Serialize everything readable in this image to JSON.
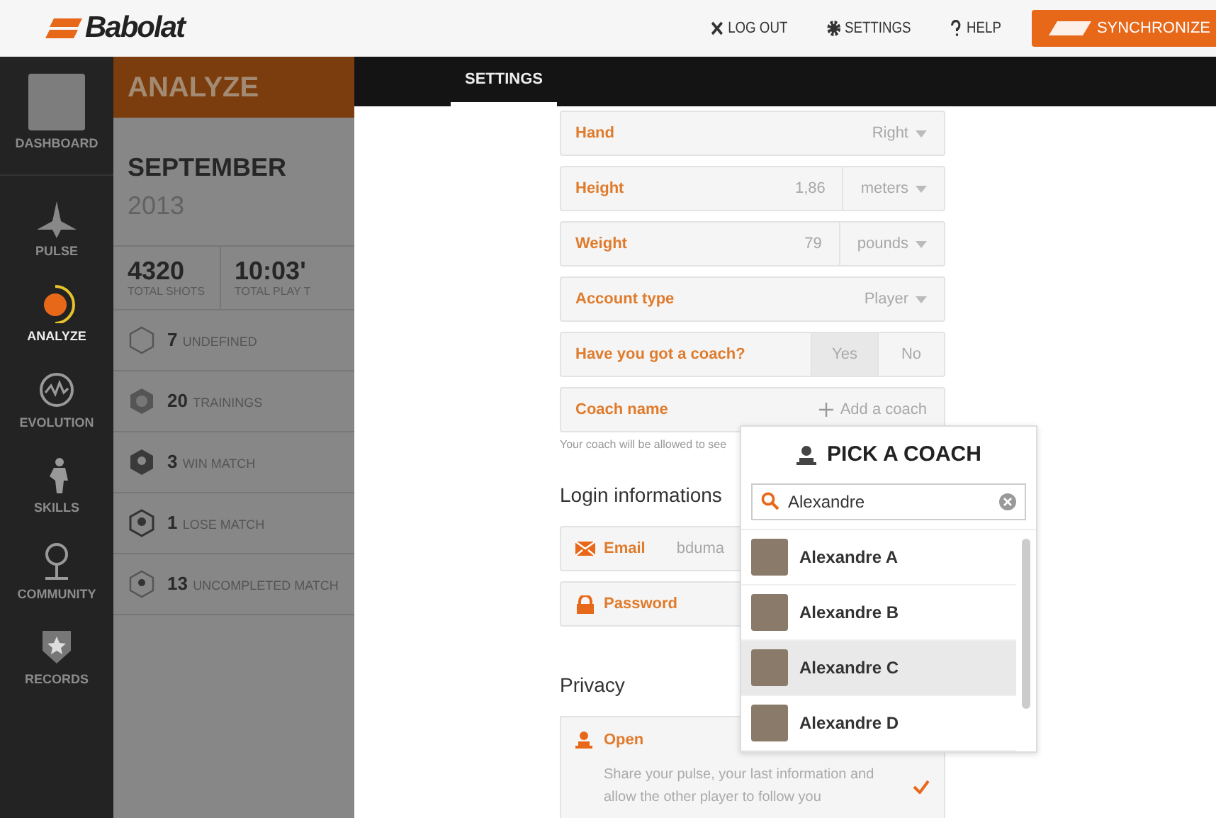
{
  "brand": {
    "logo": "Babolat"
  },
  "top_nav": [
    {
      "kind": "close",
      "label": "LOG OUT"
    },
    {
      "kind": "gear",
      "label": "SETTINGS"
    },
    {
      "kind": "help",
      "label": "HELP"
    }
  ],
  "sync_button": {
    "label": "SYNCHRONIZE"
  },
  "sidebar": {
    "items": [
      {
        "kind": "avatar",
        "label": "DASHBOARD",
        "selected": false
      },
      {
        "kind": "pulse",
        "label": "PULSE",
        "selected": false
      },
      {
        "kind": "analyze",
        "label": "ANALYZE",
        "selected": true
      },
      {
        "kind": "evolution",
        "label": "EVOLUTION",
        "selected": false
      },
      {
        "kind": "skills",
        "label": "SKILLS",
        "selected": false
      },
      {
        "kind": "community",
        "label": "COMMUNITY",
        "selected": false
      },
      {
        "kind": "records",
        "label": "RECORDS",
        "selected": false
      }
    ]
  },
  "analyze_panel": {
    "title": "ANALYZE",
    "month": "SEPTEMBER",
    "year": "2013",
    "totals": [
      {
        "value": "4320",
        "label": "TOTAL SHOTS"
      },
      {
        "value": "10:03'",
        "label": "TOTAL PLAY T"
      }
    ],
    "stats": [
      {
        "kind": "undefined",
        "count": "7",
        "label": "UNDEFINED"
      },
      {
        "kind": "training",
        "count": "20",
        "label": "TRAININGS"
      },
      {
        "kind": "win",
        "count": "3",
        "label": "WIN MATCH"
      },
      {
        "kind": "lose",
        "count": "1",
        "label": "LOSE MATCH"
      },
      {
        "kind": "uncompleted",
        "count": "13",
        "label": "UNCOMPLETED MATCH"
      }
    ]
  },
  "tabs": [
    {
      "label": "SETTINGS",
      "selected": true
    }
  ],
  "settings": {
    "fields": [
      {
        "kind": "select",
        "label": "Hand",
        "value": "Right"
      },
      {
        "kind": "measure",
        "label": "Height",
        "value": "1,86",
        "unit": "meters"
      },
      {
        "kind": "measure",
        "label": "Weight",
        "value": "79",
        "unit": "pounds"
      },
      {
        "kind": "select",
        "label": "Account type",
        "value": "Player"
      },
      {
        "kind": "toggle",
        "label": "Have you got a coach?",
        "options": [
          {
            "label": "Yes",
            "selected": true
          },
          {
            "label": "No",
            "selected": false
          }
        ]
      },
      {
        "kind": "action",
        "label": "Coach name",
        "action": "Add a coach"
      }
    ],
    "coach_hint": "Your coach will be allowed to see",
    "login": {
      "title": "Login informations",
      "fields": [
        {
          "kind": "email",
          "label": "Email",
          "value": "bduma"
        },
        {
          "kind": "password",
          "label": "Password"
        }
      ]
    },
    "privacy": {
      "title": "Privacy",
      "options": [
        {
          "label": "Open",
          "description": "Share your pulse, your last information and allow the other player to follow you",
          "selected": true
        }
      ]
    }
  },
  "coach_picker": {
    "title": "PICK A COACH",
    "search": {
      "value": "Alexandre"
    },
    "results": [
      {
        "name": "Alexandre A",
        "selected": false
      },
      {
        "name": "Alexandre B",
        "selected": false
      },
      {
        "name": "Alexandre C",
        "selected": true
      },
      {
        "name": "Alexandre D",
        "selected": false
      }
    ]
  }
}
